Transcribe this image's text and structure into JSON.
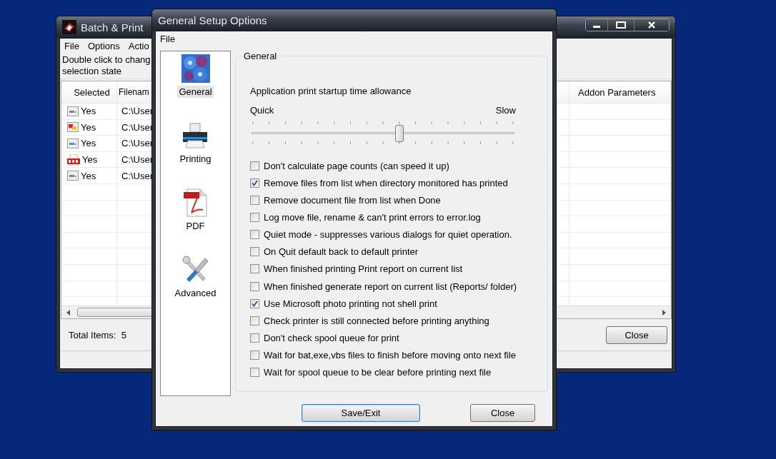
{
  "main_window": {
    "title": "Batch & Print",
    "menu": [
      "File",
      "Options",
      "Actio"
    ],
    "hint_lines": [
      "Double click to chang",
      "selection state"
    ],
    "columns": [
      {
        "label": "Selected"
      },
      {
        "label": "Filenam"
      },
      {
        "label": "Addon Parameters"
      }
    ],
    "rows": [
      {
        "kind": "image",
        "selected": "Yes",
        "filename": "C:\\User"
      },
      {
        "kind": "photo",
        "selected": "Yes",
        "filename": "C:\\User"
      },
      {
        "kind": "image",
        "selected": "Yes",
        "filename": "C:\\User"
      },
      {
        "kind": "pdf",
        "selected": "Yes",
        "filename": "C:\\User"
      },
      {
        "kind": "image",
        "selected": "Yes",
        "filename": "C:\\User"
      }
    ],
    "total_label": "Total Items:",
    "total_value": "5",
    "close_button": "Close"
  },
  "dialog": {
    "title": "General Setup Options",
    "menu": [
      "File"
    ],
    "nav": [
      {
        "kind": "general",
        "label": "General",
        "selected": true
      },
      {
        "kind": "printer",
        "label": "Printing",
        "selected": false
      },
      {
        "kind": "pdf",
        "label": "PDF",
        "selected": false
      },
      {
        "kind": "tools",
        "label": "Advanced",
        "selected": false
      }
    ],
    "group_title": "General",
    "slider": {
      "label": "Application print startup time allowance",
      "min_label": "Quick",
      "max_label": "Slow",
      "level": 0.5625
    },
    "options": [
      {
        "label": "Don't calculate page counts (can speed it up)",
        "checked": false
      },
      {
        "label": "Remove files from list when directory monitored has printed",
        "checked": true
      },
      {
        "label": "Remove document file from list when Done",
        "checked": false
      },
      {
        "label": "Log move file, rename & can't print errors to error.log",
        "checked": false
      },
      {
        "label": "Quiet mode - suppresses various dialogs for quiet operation.",
        "checked": false
      },
      {
        "label": "On Quit default back to default printer",
        "checked": false
      },
      {
        "label": "When finished printing Print report on current list",
        "checked": false
      },
      {
        "label": "When finished generate report on current list (Reports/ folder)",
        "checked": false
      },
      {
        "label": "Use Microsoft photo printing not shell print",
        "checked": true
      },
      {
        "label": "Check printer is still connected before printing anything",
        "checked": false
      },
      {
        "label": "Don't check spool queue for print",
        "checked": false
      },
      {
        "label": "Wait for bat,exe,vbs files to finish before moving onto next file",
        "checked": false
      },
      {
        "label": "Wait for spool queue to be clear before printing next file",
        "checked": false
      }
    ],
    "buttons": [
      {
        "label": "Save/Exit",
        "kind": "default"
      },
      {
        "label": "Close",
        "kind": "normal"
      }
    ]
  }
}
